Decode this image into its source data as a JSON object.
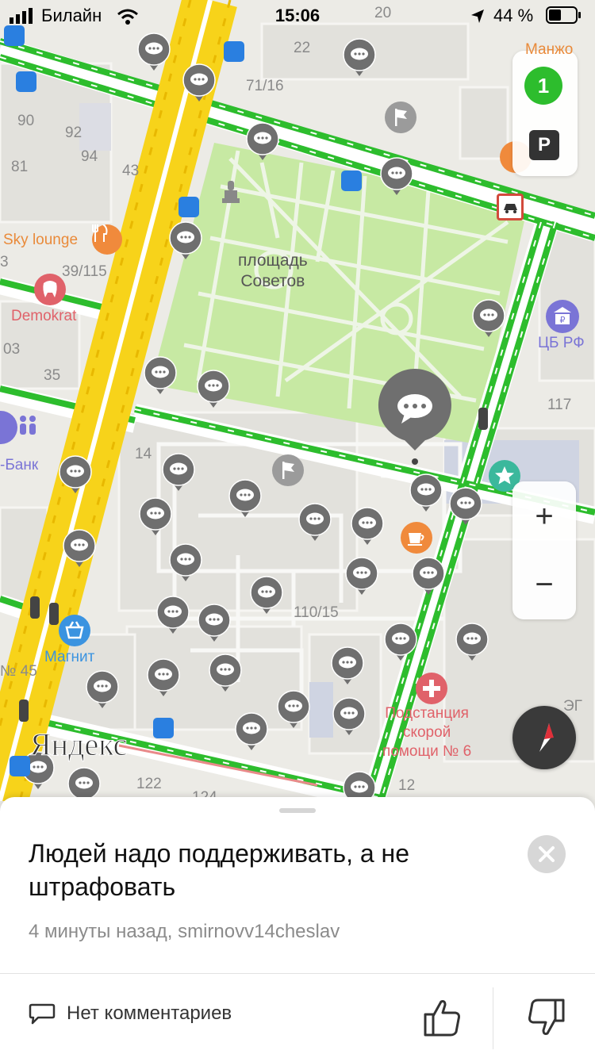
{
  "status_bar": {
    "carrier": "Билайн",
    "time": "15:06",
    "battery_percent": "44 %"
  },
  "map": {
    "square_label_line1": "площадь",
    "square_label_line2": "Советов",
    "house_numbers": [
      "20",
      "22",
      "71/16",
      "90",
      "92",
      "94",
      "81",
      "43",
      "39/115",
      "3",
      "03",
      "35",
      "14",
      "117",
      "110/15",
      "№ 45",
      "122",
      "124",
      "12",
      "ЭГ"
    ],
    "poi": {
      "sky_lounge": "Sky lounge",
      "demokrat": "Demokrat",
      "cb_rf": "ЦБ РФ",
      "bank": "-Банк",
      "magnit": "Магнит",
      "substation_line1": "Подстанция",
      "substation_line2": "скорой",
      "substation_line3": "помощи № 6",
      "manjo": "Манжо"
    },
    "brand_watermark": "Яндекс",
    "traffic_level": "1",
    "parking_label": "P",
    "zoom_in_label": "+",
    "zoom_out_label": "−",
    "colors": {
      "traffic_green": "#2dbd2d",
      "main_road_yellow": "#f7d31a",
      "park_green": "#c7e9a3",
      "pin_gray": "#6f6f6f",
      "transit_blue": "#2a7fe0"
    }
  },
  "sheet": {
    "title": "Людей надо поддерживать, а не штрафовать",
    "meta": "4 минуты назад, smirnovv14cheslav",
    "comments_label": "Нет комментариев"
  }
}
